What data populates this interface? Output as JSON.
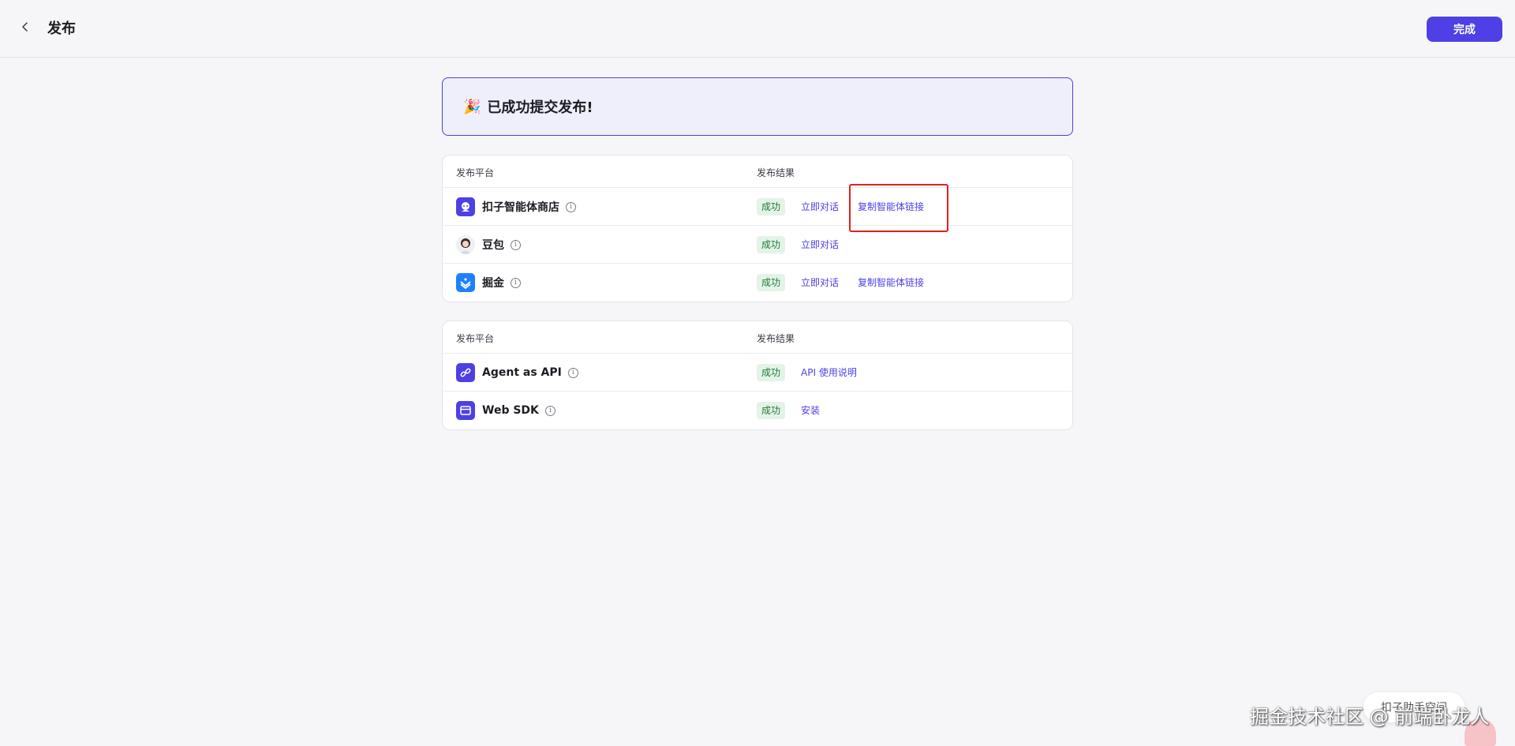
{
  "header": {
    "title": "发布",
    "done_label": "完成"
  },
  "banner": {
    "emoji": "🎉",
    "message": "已成功提交发布!"
  },
  "store_table": {
    "col_platform": "发布平台",
    "col_result": "发布结果",
    "rows": [
      {
        "name": "扣子智能体商店",
        "icon": "coze-store-icon",
        "status": "成功",
        "action1": "立即对话",
        "action2": "复制智能体链接"
      },
      {
        "name": "豆包",
        "icon": "doubao-avatar-icon",
        "status": "成功",
        "action1": "立即对话"
      },
      {
        "name": "掘金",
        "icon": "juejin-icon",
        "status": "成功",
        "action1": "立即对话",
        "action2": "复制智能体链接"
      }
    ]
  },
  "api_table": {
    "col_platform": "发布平台",
    "col_result": "发布结果",
    "rows": [
      {
        "name": "Agent as API",
        "icon": "api-link-icon",
        "status": "成功",
        "action1": "API 使用说明"
      },
      {
        "name": "Web SDK",
        "icon": "web-sdk-icon",
        "status": "成功",
        "action1": "安装"
      }
    ]
  },
  "floating": {
    "pill_text": "扣子助手空间"
  },
  "watermark": "掘金技术社区 @ 前端卧龙人",
  "colors": {
    "accent": "#4e40e5",
    "success_bg": "#e3f4e7",
    "success_text": "#1f7a38",
    "highlight": "#e02020"
  }
}
